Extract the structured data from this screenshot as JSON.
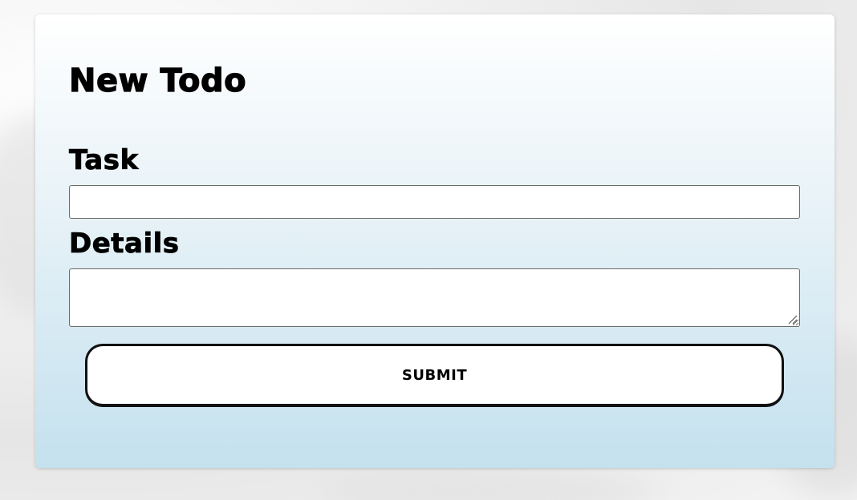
{
  "form": {
    "title": "New Todo",
    "task_label": "Task",
    "task_value": "",
    "task_placeholder": "",
    "details_label": "Details",
    "details_value": "",
    "details_placeholder": "",
    "submit_label": "SUBMIT"
  },
  "colors": {
    "card_top": "#ffffff",
    "card_bottom": "#c4e1ee",
    "text": "#000000",
    "input_border": "#6b6b6b",
    "button_border": "#111111"
  }
}
